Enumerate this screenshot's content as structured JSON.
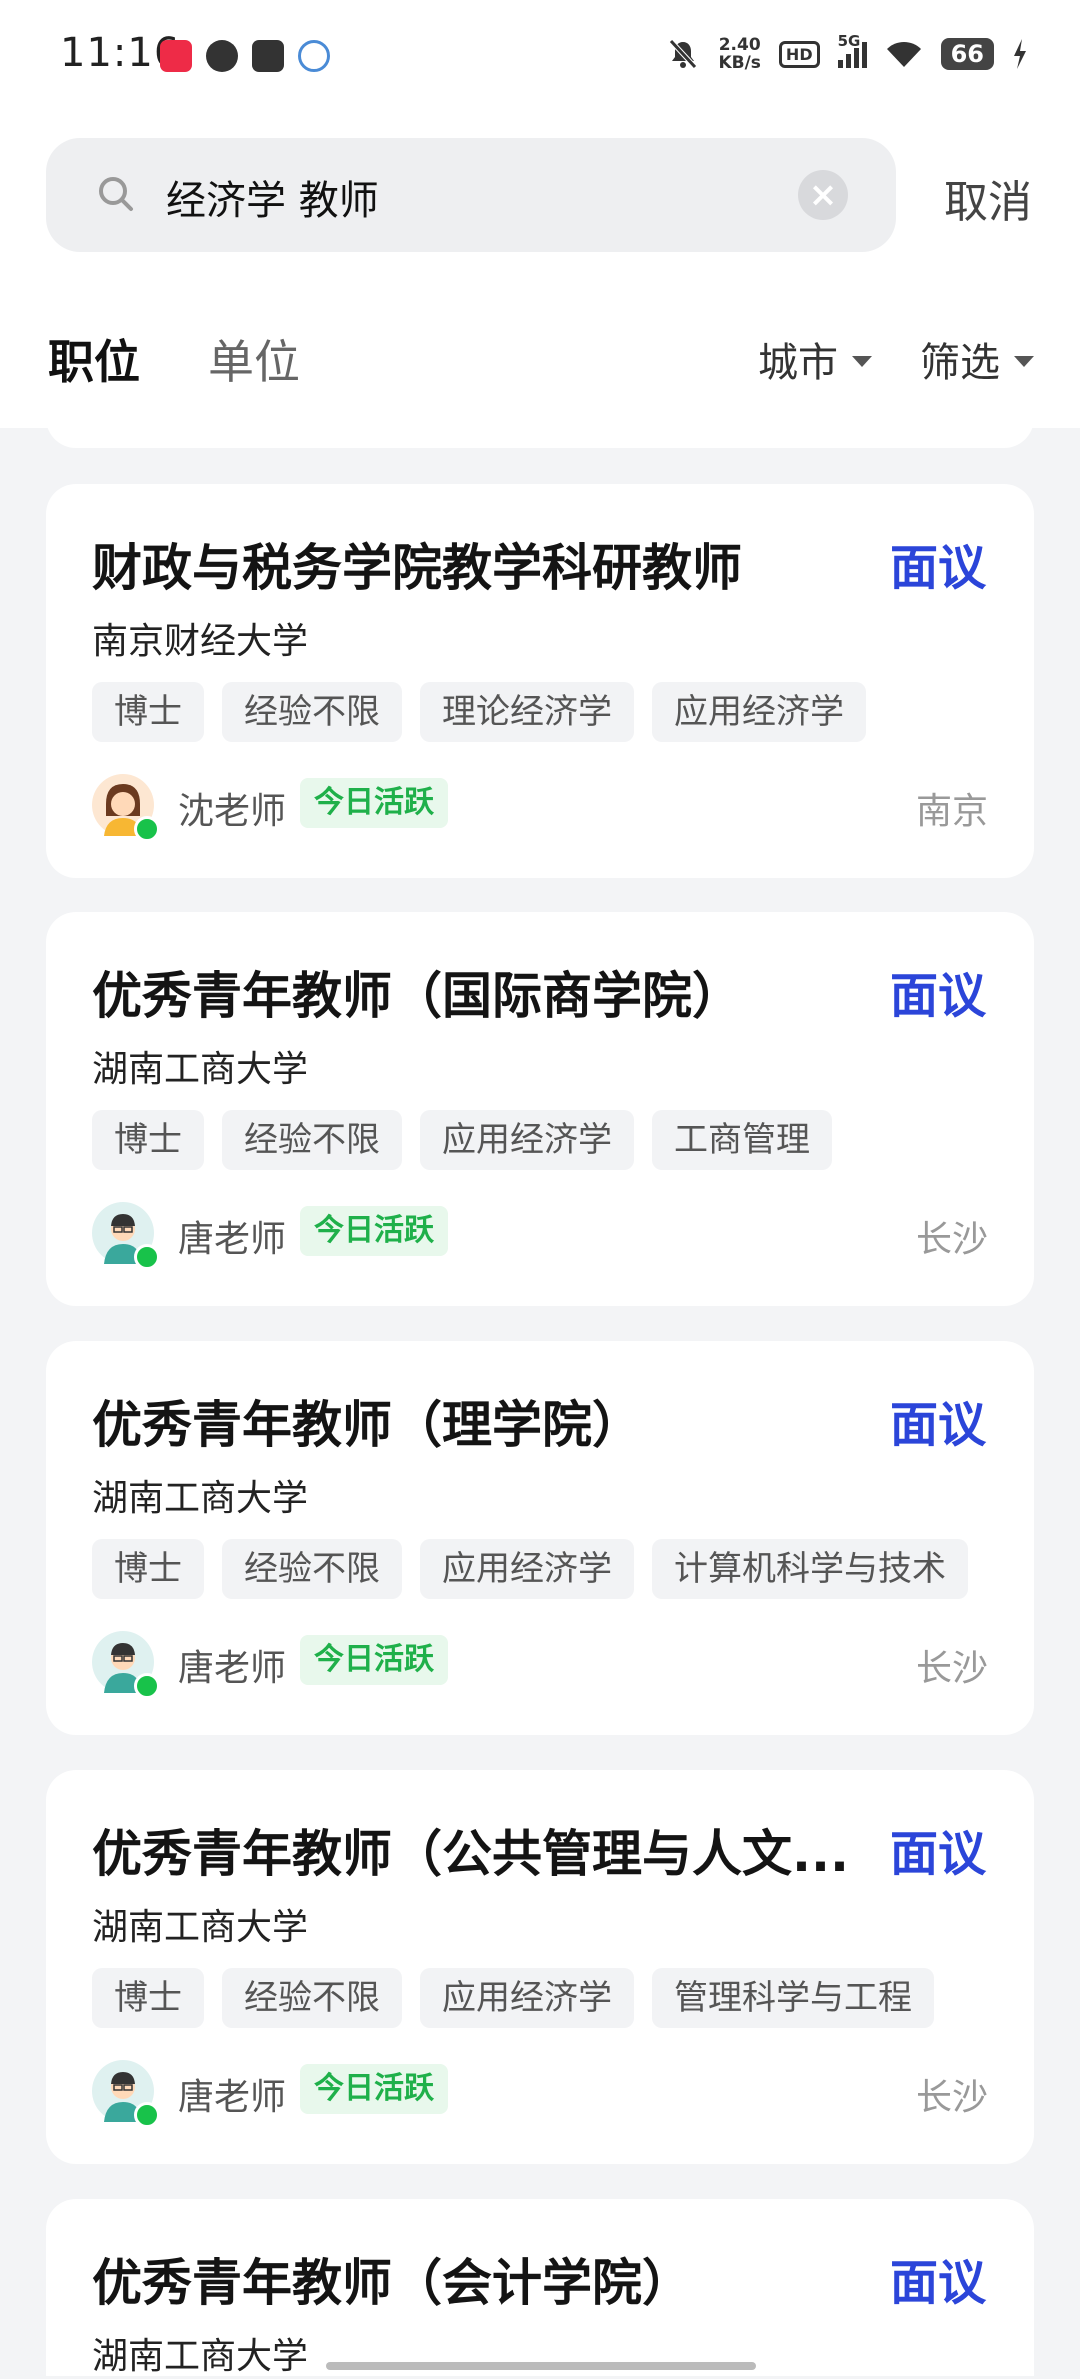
{
  "status_bar": {
    "time": "11:16",
    "speed_top": "2.40",
    "speed_bottom": "KB/s",
    "hd": "HD",
    "network": "5G",
    "battery": "66"
  },
  "search": {
    "query": "经济学 教师",
    "cancel_label": "取消"
  },
  "tabs": [
    {
      "label": "职位",
      "active": true
    },
    {
      "label": "单位",
      "active": false
    }
  ],
  "filters": {
    "city_label": "城市",
    "filter_label": "筛选"
  },
  "jobs": [
    {
      "title": "财政与税务学院教学科研教师",
      "salary": "面议",
      "org": "南京财经大学",
      "tags": [
        "博士",
        "经验不限",
        "理论经济学",
        "应用经济学"
      ],
      "hr_name": "沈老师",
      "active": "今日活跃",
      "city": "南京"
    },
    {
      "title": "优秀青年教师（国际商学院）",
      "salary": "面议",
      "org": "湖南工商大学",
      "tags": [
        "博士",
        "经验不限",
        "应用经济学",
        "工商管理"
      ],
      "hr_name": "唐老师",
      "active": "今日活跃",
      "city": "长沙"
    },
    {
      "title": "优秀青年教师（理学院）",
      "salary": "面议",
      "org": "湖南工商大学",
      "tags": [
        "博士",
        "经验不限",
        "应用经济学",
        "计算机科学与技术"
      ],
      "hr_name": "唐老师",
      "active": "今日活跃",
      "city": "长沙"
    },
    {
      "title": "优秀青年教师（公共管理与人文...",
      "salary": "面议",
      "org": "湖南工商大学",
      "tags": [
        "博士",
        "经验不限",
        "应用经济学",
        "管理科学与工程"
      ],
      "hr_name": "唐老师",
      "active": "今日活跃",
      "city": "长沙"
    },
    {
      "title": "优秀青年教师（会计学院）",
      "salary": "面议",
      "org": "湖南工商大学"
    }
  ],
  "colors": {
    "accent": "#2f58e8",
    "salary": "#2b45d9",
    "active_green": "#1fb04a",
    "online_dot": "#18c24a"
  }
}
